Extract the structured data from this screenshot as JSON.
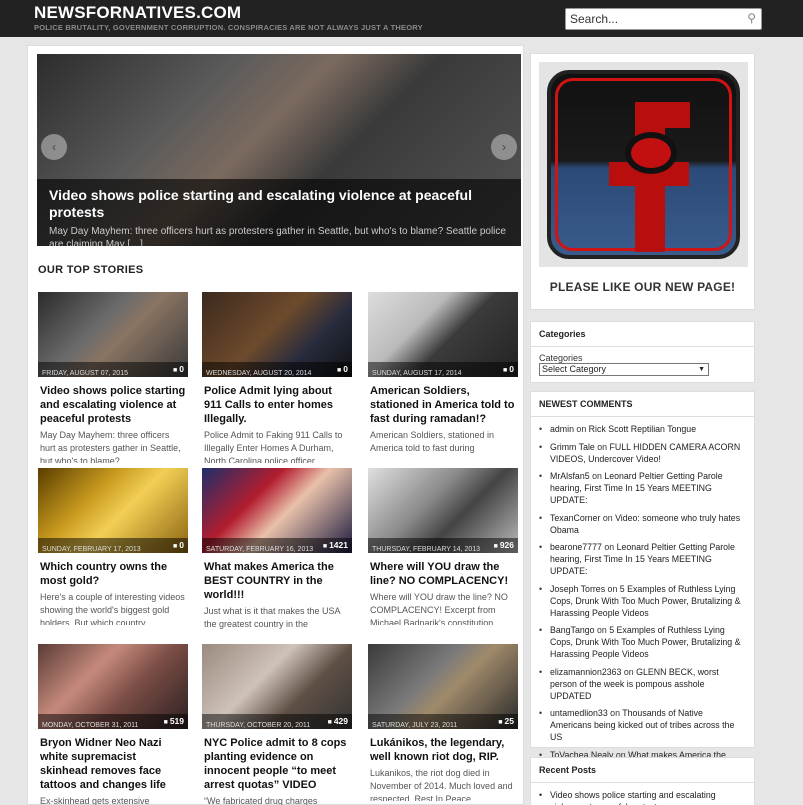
{
  "header": {
    "title": "NEWSFORNATIVES.COM",
    "tagline": "POLICE BRUTALITY, GOVERNMENT CORRUPTION. CONSPIRACIES ARE NOT ALWAYS JUST A THEORY",
    "search_placeholder": "Search..."
  },
  "slider": {
    "title": "Video shows police starting and escalating violence at peaceful protests",
    "excerpt": "May Day Mayhem: three officers hurt as protesters gather in Seattle, but who's to blame? Seattle police are claiming May […]",
    "prev_icon": "‹",
    "next_icon": "›"
  },
  "top_stories": {
    "heading": "OUR TOP STORIES",
    "cards": [
      {
        "date": "FRIDAY, AUGUST 07, 2015",
        "count": "0",
        "title": "Video shows police starting and escalating violence at peaceful protests",
        "excerpt": "May Day Mayhem: three officers hurt as protesters gather in Seattle, but who's to blame?"
      },
      {
        "date": "WEDNESDAY, AUGUST 20, 2014",
        "count": "0",
        "title": "Police Admit lying about 911 Calls to enter homes Illegally.",
        "excerpt": "Police Admit to Faking 911 Calls to Illegally Enter Homes   A Durham, North Carolina police officer"
      },
      {
        "date": "SUNDAY, AUGUST 17, 2014",
        "count": "0",
        "title": "American Soldiers, stationed in America told to fast during ramadan!?",
        "excerpt": "American Soldiers, stationed in America told to fast during"
      },
      {
        "date": "SUNDAY, FEBRUARY 17, 2013",
        "count": "0",
        "title": "Which country owns the most gold?",
        "excerpt": "Here's a couple of interesting videos showing the world's biggest gold holders. But which country"
      },
      {
        "date": "SATURDAY, FEBRUARY 16, 2013",
        "count": "1421",
        "title": "What makes America the BEST COUNTRY in the world!!!",
        "excerpt": "Just what is it that makes the USA the greatest country in the"
      },
      {
        "date": "THURSDAY, FEBRUARY 14, 2013",
        "count": "926",
        "title": "Where will YOU draw the line? NO COMPLACENCY!",
        "excerpt": "Where will YOU draw the line? NO COMPLACENCY! Excerpt from Michael Badnarik's constitution"
      },
      {
        "date": "MONDAY, OCTOBER 31, 2011",
        "count": "519",
        "title": "Bryon Widner Neo Nazi white supremacist skinhead removes face tattoos and changes life",
        "excerpt": "Ex-skinhead gets extensive"
      },
      {
        "date": "THURSDAY, OCTOBER 20, 2011",
        "count": "429",
        "title": "NYC Police admit to 8 cops planting evidence on innocent people “to meet arrest quotas” VIDEO",
        "excerpt": "“We fabricated drug charges"
      },
      {
        "date": "SATURDAY, JULY 23, 2011",
        "count": "25",
        "title": "Lukánikos, the legendary, well known riot dog, RIP.",
        "excerpt": "Lukanikos, the riot dog died in November of 2014.  Much loved and respected.  Rest In Peace."
      }
    ]
  },
  "sidebar": {
    "promo_text": "PLEASE LIKE OUR NEW PAGE!",
    "categories": {
      "title": "Categories",
      "label": "Categories",
      "selected": "Select Category"
    },
    "newest_comments": {
      "title": "NEWEST COMMENTS",
      "items": [
        {
          "author": "admin",
          "on": "on",
          "post": "Rick Scott Reptilian Tongue"
        },
        {
          "author": "Grimm Tale",
          "on": "on",
          "post": "FULL HIDDEN CAMERA ACORN VIDEOS, Undercover Video!"
        },
        {
          "author": "MrAlsfan5",
          "on": "on",
          "post": "Leonard Peltier Getting Parole hearing, First Time In 15 Years MEETING UPDATE:"
        },
        {
          "author": "TexanCorner",
          "on": "on",
          "post": "Video: someone who truly hates Obama"
        },
        {
          "author": "bearone7777",
          "on": "on",
          "post": "Leonard Peltier Getting Parole hearing, First Time In 15 Years MEETING UPDATE:"
        },
        {
          "author": "Joseph Torres",
          "on": "on",
          "post": "5 Examples of Ruthless Lying Cops, Drunk With Too Much Power, Brutalizing & Harassing People Videos"
        },
        {
          "author": "BangTango",
          "on": "on",
          "post": "5 Examples of Ruthless Lying Cops, Drunk With Too Much Power, Brutalizing & Harassing People Videos"
        },
        {
          "author": "elizamannion2363",
          "on": "on",
          "post": "GLENN BECK, worst person of the week is pompous asshole UPDATED"
        },
        {
          "author": "untamedlion33",
          "on": "on",
          "post": "Thousands of Native Americans being kicked out of tribes across the US"
        },
        {
          "author": "ToVachea Nealy",
          "on": "on",
          "post": "What makes America the BEST COUNTRY in the world!!!"
        }
      ]
    },
    "recent_posts": {
      "title": "Recent Posts",
      "items": [
        "Video shows police starting and escalating violence at peaceful protests"
      ]
    }
  },
  "colors": {
    "header_bg": "#222222",
    "promo_red": "#b80e0e",
    "promo_blue": "#3a5b8c"
  },
  "icons": {
    "search": "search-icon",
    "comment": "comment-icon",
    "arrow_prev": "chevron-left-icon",
    "arrow_next": "chevron-right-icon"
  }
}
